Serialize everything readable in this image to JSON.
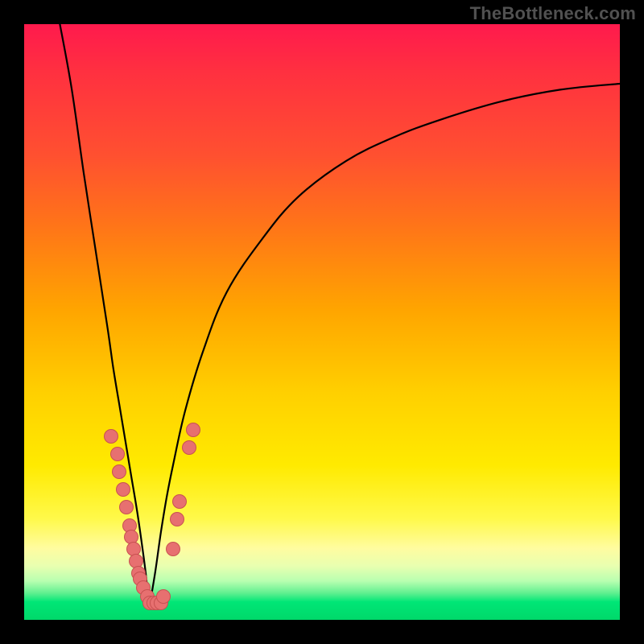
{
  "watermark": "TheBottleneck.com",
  "colors": {
    "frame": "#000000",
    "curve": "#000000",
    "marker_fill": "#e77070",
    "marker_border": "rgba(180,60,60,0.6)",
    "gradient_top": "#ff1a4d",
    "gradient_bottom": "#00d86a"
  },
  "chart_data": {
    "type": "line",
    "title": "",
    "xlabel": "",
    "ylabel": "",
    "xlim": [
      0,
      100
    ],
    "ylim": [
      0,
      100
    ],
    "grid": false,
    "legend": false,
    "note": "Two curve branches descending to a sharp minimum near x≈21, then rising asymptotically; red markers cluster near the trough on both branches.",
    "series": [
      {
        "name": "left_branch",
        "x": [
          6,
          8,
          10,
          12,
          14,
          15,
          16,
          17,
          18,
          19,
          20,
          20.5,
          21
        ],
        "y": [
          100,
          89,
          75,
          62,
          49,
          42,
          36,
          30,
          24,
          18,
          11,
          7,
          2
        ]
      },
      {
        "name": "right_branch",
        "x": [
          21,
          22,
          23,
          24,
          25,
          27,
          30,
          34,
          40,
          46,
          54,
          62,
          70,
          80,
          90,
          100
        ],
        "y": [
          2,
          8,
          15,
          21,
          26,
          35,
          45,
          55,
          64,
          71,
          77,
          81,
          84,
          87,
          89,
          90
        ]
      }
    ],
    "markers": [
      {
        "x": 14.5,
        "y": 31
      },
      {
        "x": 15.5,
        "y": 28
      },
      {
        "x": 15.8,
        "y": 25
      },
      {
        "x": 16.5,
        "y": 22
      },
      {
        "x": 17.0,
        "y": 19
      },
      {
        "x": 17.5,
        "y": 16
      },
      {
        "x": 17.8,
        "y": 14
      },
      {
        "x": 18.3,
        "y": 12
      },
      {
        "x": 18.6,
        "y": 10
      },
      {
        "x": 19.0,
        "y": 8
      },
      {
        "x": 19.3,
        "y": 7
      },
      {
        "x": 19.8,
        "y": 5.5
      },
      {
        "x": 20.5,
        "y": 4
      },
      {
        "x": 21.0,
        "y": 3
      },
      {
        "x": 21.6,
        "y": 3
      },
      {
        "x": 22.2,
        "y": 3
      },
      {
        "x": 22.8,
        "y": 3
      },
      {
        "x": 23.3,
        "y": 4
      },
      {
        "x": 24.8,
        "y": 12
      },
      {
        "x": 25.6,
        "y": 17
      },
      {
        "x": 26.0,
        "y": 20
      },
      {
        "x": 27.6,
        "y": 29
      },
      {
        "x": 28.2,
        "y": 32
      }
    ]
  }
}
